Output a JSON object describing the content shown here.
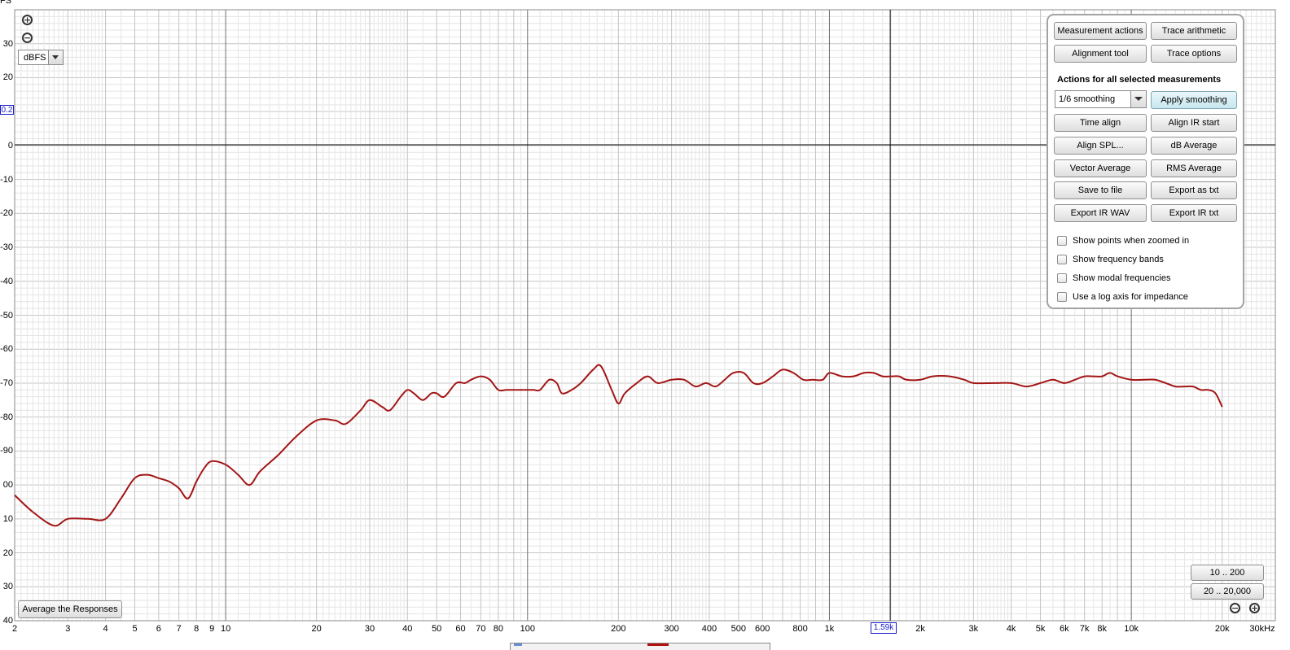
{
  "y_axis": {
    "unit_label": "FS",
    "tick_labels": [
      {
        "value": 30,
        "text": "30"
      },
      {
        "value": 20,
        "text": "20"
      },
      {
        "value": 0,
        "text": "0"
      },
      {
        "value": -10,
        "text": "-10"
      },
      {
        "value": -20,
        "text": "-20"
      },
      {
        "value": -30,
        "text": "-30"
      },
      {
        "value": -40,
        "text": "-40"
      },
      {
        "value": -50,
        "text": "-50"
      },
      {
        "value": -60,
        "text": "-60"
      },
      {
        "value": -70,
        "text": "-70"
      },
      {
        "value": -80,
        "text": "-80"
      },
      {
        "value": -90,
        "text": "-90"
      },
      {
        "value": -100,
        "text": "00"
      },
      {
        "value": -110,
        "text": "10"
      },
      {
        "value": -120,
        "text": "20"
      },
      {
        "value": -130,
        "text": "30"
      },
      {
        "value": -140,
        "text": "40"
      }
    ],
    "cursor_readout": "0.2"
  },
  "x_axis": {
    "tick_labels": [
      {
        "value": 2,
        "text": "2"
      },
      {
        "value": 3,
        "text": "3"
      },
      {
        "value": 4,
        "text": "4"
      },
      {
        "value": 5,
        "text": "5"
      },
      {
        "value": 6,
        "text": "6"
      },
      {
        "value": 7,
        "text": "7"
      },
      {
        "value": 8,
        "text": "8"
      },
      {
        "value": 9,
        "text": "9"
      },
      {
        "value": 10,
        "text": "10"
      },
      {
        "value": 20,
        "text": "20"
      },
      {
        "value": 30,
        "text": "30"
      },
      {
        "value": 40,
        "text": "40"
      },
      {
        "value": 50,
        "text": "50"
      },
      {
        "value": 60,
        "text": "60"
      },
      {
        "value": 70,
        "text": "70"
      },
      {
        "value": 80,
        "text": "80"
      },
      {
        "value": 100,
        "text": "100"
      },
      {
        "value": 200,
        "text": "200"
      },
      {
        "value": 300,
        "text": "300"
      },
      {
        "value": 400,
        "text": "400"
      },
      {
        "value": 500,
        "text": "500"
      },
      {
        "value": 600,
        "text": "600"
      },
      {
        "value": 800,
        "text": "800"
      },
      {
        "value": 1000,
        "text": "1k"
      },
      {
        "value": 2000,
        "text": "2k"
      },
      {
        "value": 3000,
        "text": "3k"
      },
      {
        "value": 4000,
        "text": "4k"
      },
      {
        "value": 5000,
        "text": "5k"
      },
      {
        "value": 6000,
        "text": "6k"
      },
      {
        "value": 7000,
        "text": "7k"
      },
      {
        "value": 8000,
        "text": "8k"
      },
      {
        "value": 10000,
        "text": "10k"
      },
      {
        "value": 20000,
        "text": "20k"
      },
      {
        "value": 30000,
        "text": "30kHz"
      }
    ],
    "cursor_readout": "1.59k"
  },
  "unit_select": {
    "value": "dBFS"
  },
  "left_button": {
    "label": "Average the Responses"
  },
  "range_buttons": {
    "range_1": "10 .. 200",
    "range_2": "20 .. 20,000"
  },
  "panel": {
    "measurement_actions": "Measurement actions",
    "trace_arithmetic": "Trace arithmetic",
    "alignment_tool": "Alignment tool",
    "trace_options": "Trace options",
    "heading": "Actions for all selected measurements",
    "smoothing_value": "1/6 smoothing",
    "apply_smoothing": "Apply smoothing",
    "time_align": "Time align",
    "align_ir_start": "Align IR start",
    "align_spl": "Align SPL...",
    "db_average": "dB Average",
    "vector_average": "Vector Average",
    "rms_average": "RMS Average",
    "save_to_file": "Save to file",
    "export_as_txt": "Export as txt",
    "export_ir_wav": "Export IR WAV",
    "export_ir_txt": "Export IR txt",
    "checkboxes": {
      "show_points": "Show points when zoomed in",
      "show_bands": "Show frequency bands",
      "show_modal": "Show modal frequencies",
      "log_axis": "Use a log axis for impedance"
    }
  },
  "colors": {
    "trace": "#a31515",
    "grid_major": "#6e6e6e",
    "grid_minor": "#d9d9d9",
    "cursor": "#000000",
    "readout": "#1a1acc"
  },
  "chart_data": {
    "type": "line",
    "x_scale": "log",
    "xlim": [
      2,
      30000
    ],
    "ylim": [
      -140,
      40
    ],
    "grid": true,
    "series": [
      {
        "color": "#a31515",
        "x": [
          2,
          2.3,
          2.7,
          3,
          3.5,
          4,
          4.5,
          5,
          5.5,
          6,
          6.5,
          7,
          7.5,
          8,
          8.5,
          9,
          10,
          11,
          12,
          13,
          15,
          17,
          20,
          23,
          25,
          28,
          30,
          33,
          35,
          38,
          40,
          42,
          45,
          48,
          50,
          53,
          58,
          62,
          65,
          70,
          75,
          80,
          85,
          90,
          95,
          100,
          105,
          110,
          118,
          125,
          130,
          140,
          150,
          165,
          175,
          190,
          200,
          210,
          230,
          250,
          270,
          300,
          330,
          360,
          390,
          420,
          450,
          480,
          520,
          560,
          600,
          650,
          700,
          760,
          820,
          880,
          950,
          1000,
          1100,
          1200,
          1300,
          1400,
          1500,
          1600,
          1700,
          1800,
          2000,
          2200,
          2500,
          2800,
          3000,
          3500,
          4000,
          4500,
          5000,
          5500,
          6000,
          6500,
          7000,
          7500,
          8000,
          8500,
          9000,
          10000,
          11000,
          12000,
          13000,
          14000,
          15000,
          16000,
          17000,
          18000,
          19000,
          20000
        ],
        "y": [
          -103,
          -108,
          -112,
          -110,
          -110,
          -110,
          -104,
          -98,
          -97,
          -98,
          -99,
          -101,
          -104,
          -99,
          -95,
          -93,
          -94,
          -97,
          -100,
          -96,
          -91,
          -86,
          -81,
          -81,
          -82,
          -78,
          -75,
          -77,
          -78,
          -74,
          -72,
          -73,
          -75,
          -73,
          -73,
          -74,
          -70,
          -70,
          -69,
          -68,
          -69,
          -72,
          -72,
          -72,
          -72,
          -72,
          -72,
          -72,
          -69,
          -70,
          -73,
          -72,
          -70,
          -66,
          -65,
          -72,
          -76,
          -73,
          -70,
          -68,
          -70,
          -69,
          -69,
          -71,
          -70,
          -71,
          -69,
          -67,
          -67,
          -70,
          -70,
          -68,
          -66,
          -67,
          -69,
          -69,
          -69,
          -67,
          -68,
          -68,
          -67,
          -67,
          -68,
          -68,
          -68,
          -69,
          -69,
          -68,
          -68,
          -69,
          -70,
          -70,
          -70,
          -71,
          -70,
          -69,
          -70,
          -69,
          -68,
          -68,
          -68,
          -67,
          -68,
          -69,
          -69,
          -69,
          -70,
          -71,
          -71,
          -71,
          -72,
          -72,
          -73,
          -77
        ]
      }
    ]
  }
}
